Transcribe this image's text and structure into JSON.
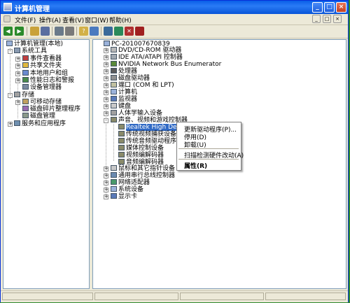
{
  "window": {
    "title": "计算机管理"
  },
  "menu": [
    {
      "label": "文件(F)"
    },
    {
      "label": "操作(A)"
    },
    {
      "label": "查看(V)"
    },
    {
      "label": "窗口(W)"
    },
    {
      "label": "帮助(H)"
    }
  ],
  "icons": {
    "back": "arrow-left-icon",
    "forward": "arrow-right-icon",
    "up": "folder-up-icon",
    "show_tree": "tree-icon",
    "properties": "properties-icon",
    "print": "print-icon",
    "help": "help-icon",
    "refresh": "refresh-icon",
    "scan": "scan-hardware-icon",
    "update": "update-driver-icon",
    "disable": "disable-device-icon",
    "uninstall": "uninstall-icon"
  },
  "left_tree": [
    {
      "label": "计算机管理(本地)"
    },
    {
      "label": "系统工具"
    },
    {
      "label": "事件查看器"
    },
    {
      "label": "共享文件夹"
    },
    {
      "label": "本地用户和组"
    },
    {
      "label": "性能日志和警报"
    },
    {
      "label": "设备管理器"
    },
    {
      "label": "存储"
    },
    {
      "label": "可移动存储"
    },
    {
      "label": "磁盘碎片整理程序"
    },
    {
      "label": "磁盘管理"
    },
    {
      "label": "服务和应用程序"
    }
  ],
  "device_tree": [
    {
      "label": "PC-201007670839"
    },
    {
      "label": "DVD/CD-ROM 驱动器"
    },
    {
      "label": "IDE ATA/ATAPI 控制器"
    },
    {
      "label": "NVIDIA Network Bus Enumerator"
    },
    {
      "label": "处理器"
    },
    {
      "label": "磁盘驱动器"
    },
    {
      "label": "端口 (COM 和 LPT)"
    },
    {
      "label": "计算机"
    },
    {
      "label": "监视器"
    },
    {
      "label": "键盘"
    },
    {
      "label": "人体学输入设备"
    },
    {
      "label": "声音、视频和游戏控制器"
    },
    {
      "label": "Realtek High Definition A"
    },
    {
      "label": "传统视频捕获设备"
    },
    {
      "label": "传统音频驱动程序"
    },
    {
      "label": "媒体控制设备"
    },
    {
      "label": "视频编解码器"
    },
    {
      "label": "音频编解码器"
    },
    {
      "label": "鼠标和其它指针设备"
    },
    {
      "label": "通用串行总线控制器"
    },
    {
      "label": "网络适配器"
    },
    {
      "label": "系统设备"
    },
    {
      "label": "显示卡"
    }
  ],
  "context_menu": {
    "items": [
      "更新驱动程序(P)...",
      "停用(D)",
      "卸载(U)",
      "扫描检测硬件改动(A)",
      "属性(R)"
    ]
  },
  "colors": {
    "titlebar": "#0a5ee8",
    "selection": "#316ac5"
  }
}
